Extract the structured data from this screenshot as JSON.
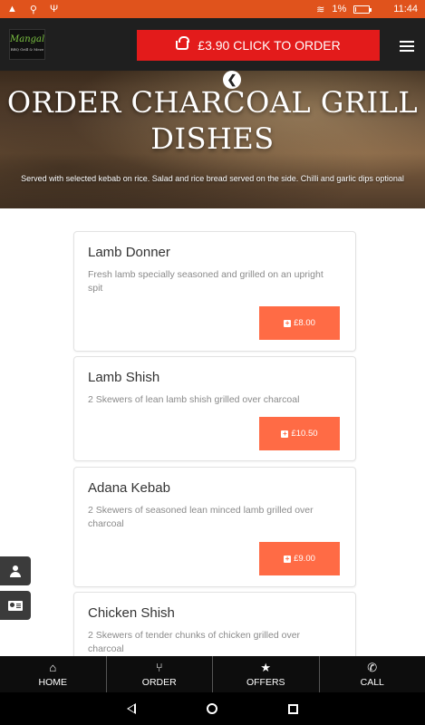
{
  "status_bar": {
    "battery": "1%",
    "time": "11:44",
    "battery_level": 0.01,
    "icons": [
      "warning-icon",
      "pin-icon",
      "usb-icon",
      "wifi-icon",
      "battery-icon"
    ]
  },
  "header": {
    "logo_text": "Mangal",
    "logo_sub": "BBQ Grill & Meze",
    "order_button": "£3.90 CLICK TO ORDER",
    "menu_icon": "hamburger-icon"
  },
  "hero": {
    "title": "ORDER CHARCOAL GRILL DISHES",
    "subtitle": "Served with selected kebab on rice. Salad and rice bread served on the side. Chilli and garlic dips optional",
    "back_icon": "arrow-left-icon"
  },
  "menu_items": [
    {
      "name": "Lamb Donner",
      "description": "Fresh lamb specially seasoned and grilled on an upright spit",
      "price": "£8.00"
    },
    {
      "name": "Lamb Shish",
      "description": "2 Skewers of lean lamb shish grilled over charcoal",
      "price": "£10.50"
    },
    {
      "name": "Adana Kebab",
      "description": "2 Skewers of seasoned lean minced lamb grilled over charcoal",
      "price": "£9.00"
    },
    {
      "name": "Chicken Shish",
      "description": "2 Skewers of tender chunks of chicken grilled over charcoal",
      "price": ""
    }
  ],
  "side_buttons": [
    "user-icon",
    "contact-card-icon"
  ],
  "bottom_nav": [
    {
      "label": "HOME",
      "icon": "home-icon"
    },
    {
      "label": "ORDER",
      "icon": "cutlery-icon"
    },
    {
      "label": "OFFERS",
      "icon": "star-icon"
    },
    {
      "label": "CALL",
      "icon": "phone-icon"
    }
  ],
  "colors": {
    "status_bar": "#e0531c",
    "order_button": "#e31b1b",
    "price_button": "#ff6b45",
    "header": "#1f1f1f"
  }
}
